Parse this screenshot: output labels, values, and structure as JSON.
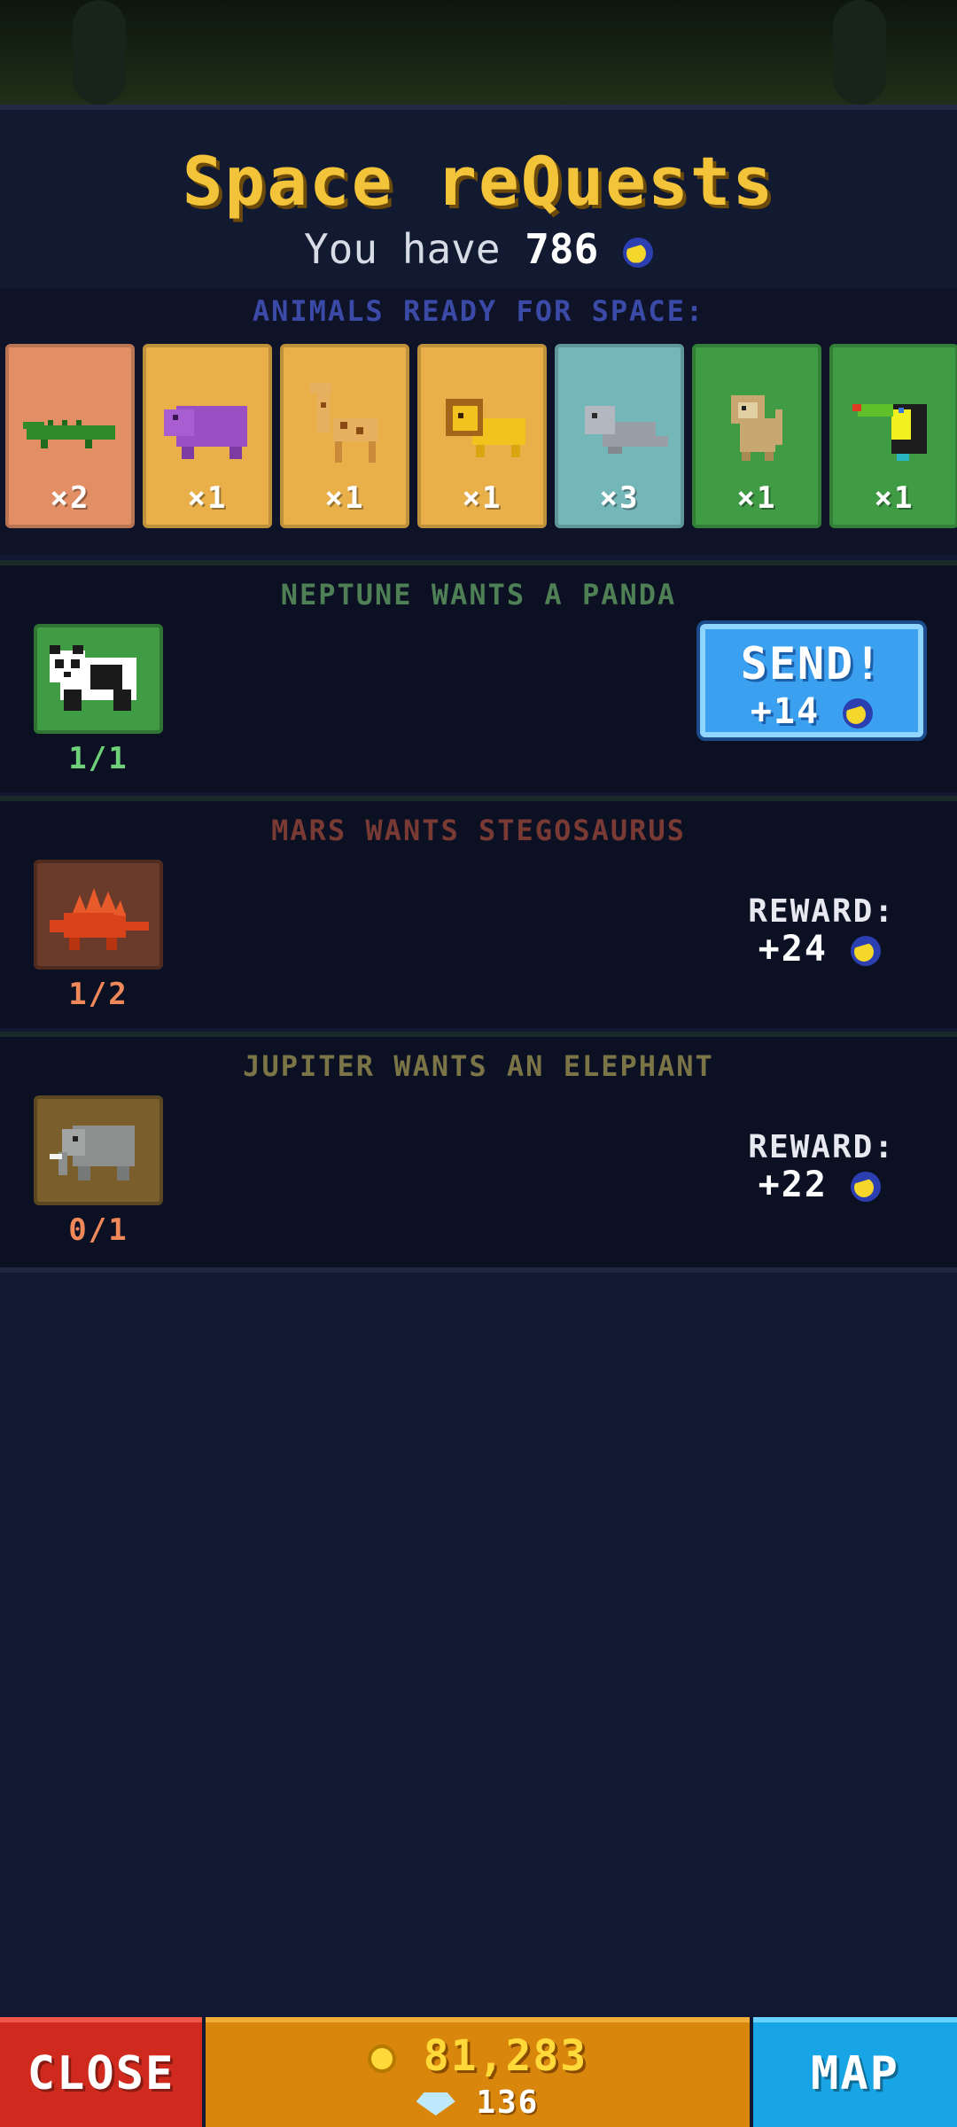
{
  "header": {
    "title": "Space reQuests",
    "subtitle_prefix": "You have",
    "balance": "786"
  },
  "ready": {
    "label": "ANIMALS READY FOR SPACE:",
    "cards": [
      {
        "animal": "crocodile-icon",
        "count": "×2",
        "color": "#e38f65"
      },
      {
        "animal": "hippo-icon",
        "count": "×1",
        "color": "#e9b04a"
      },
      {
        "animal": "giraffe-icon",
        "count": "×1",
        "color": "#e9b04a"
      },
      {
        "animal": "lion-icon",
        "count": "×1",
        "color": "#e9b04a"
      },
      {
        "animal": "seal-icon",
        "count": "×3",
        "color": "#74b7b9"
      },
      {
        "animal": "monkey-icon",
        "count": "×1",
        "color": "#3f9b44"
      },
      {
        "animal": "toucan-icon",
        "count": "×1",
        "color": "#3f9b44"
      }
    ]
  },
  "requests": [
    {
      "title": "NEPTUNE WANTS A PANDA",
      "title_color": "#4e7f55",
      "animal": "panda-icon",
      "thumb_color": "#3f9b44",
      "progress": "1/1",
      "progress_color": "#6fd07a",
      "send_label": "SEND!",
      "reward": "+14"
    },
    {
      "title": "MARS WANTS STEGOSAURUS",
      "title_color": "#7a3a34",
      "animal": "stegosaurus-icon",
      "thumb_color": "#6a3a2a",
      "progress": "1/2",
      "progress_color": "#f0885a",
      "reward_label": "REWARD:",
      "reward": "+24"
    },
    {
      "title": "JUPITER WANTS AN ELEPHANT",
      "title_color": "#7a7446",
      "animal": "elephant-icon",
      "thumb_color": "#7a5f2c",
      "progress": "0/1",
      "progress_color": "#f0885a",
      "reward_label": "REWARD:",
      "reward": "+22"
    }
  ],
  "bottom": {
    "close": "CLOSE",
    "map": "MAP",
    "gold": "81,283",
    "gems": "136"
  }
}
